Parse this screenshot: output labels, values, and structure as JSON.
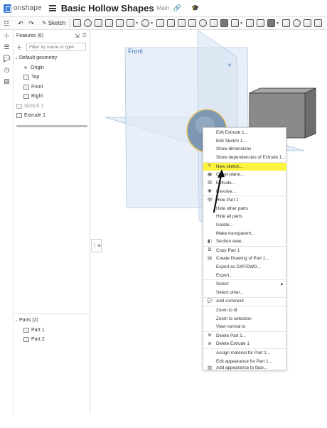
{
  "app": {
    "name": "onshape"
  },
  "document": {
    "title": "Basic Hollow Shapes",
    "branch": "Main"
  },
  "toolbar": {
    "sketch_label": "Sketch"
  },
  "features": {
    "header": "Features (6)",
    "filter_placeholder": "Filter by name or type",
    "default_geometry": "Default geometry",
    "origin": "Origin",
    "top": "Top",
    "front": "Front",
    "right": "Right",
    "sketch": "Sketch 1",
    "extrude": "Extrude 1"
  },
  "parts": {
    "header": "Parts (2)",
    "items": [
      "Part 1",
      "Part 2"
    ]
  },
  "viewport": {
    "plane_label": "Front"
  },
  "context_menu": {
    "items": [
      "Edit Extrude 1...",
      "Edit Sketch 1...",
      "Show dimensions",
      "Show dependencies of Extrude 1...",
      "New sketch...",
      "Offset plane...",
      "Extrude...",
      "Revolve...",
      "Hide Part 1",
      "Hide other parts",
      "Hide all parts",
      "Isolate...",
      "Make transparent...",
      "Section view...",
      "Copy Part 1",
      "Create Drawing of Part 1...",
      "Export as DXF/DWG...",
      "Export...",
      "Select",
      "Select other...",
      "Add comment",
      "Zoom to fit",
      "Zoom to selection",
      "View normal to",
      "Delete Part 1...",
      "Delete Extrude 1",
      "Assign material for Part 1...",
      "Edit appearance for Part 1...",
      "Add appearance to face..."
    ],
    "highlighted": "New sketch...",
    "highlight_color": "#fbf43c"
  },
  "colors": {
    "plane_fill": "#dfe9f6",
    "plane_stroke": "#8fb0d8",
    "accent": "#3a7bd5",
    "cylinder": "#7b93ad",
    "box": "#8a8a8a"
  }
}
